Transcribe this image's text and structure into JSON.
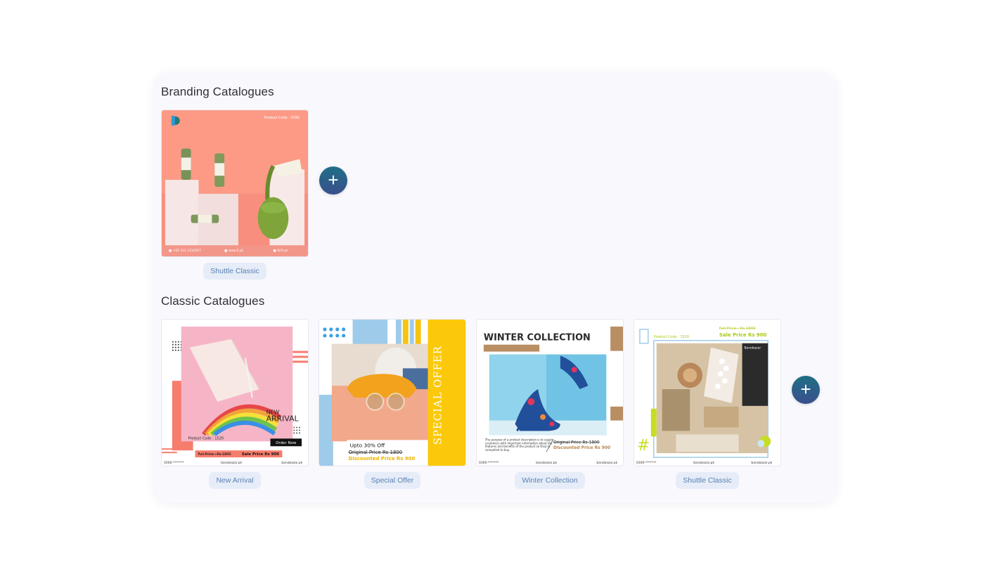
{
  "branding": {
    "title": "Branding Catalogues",
    "items": [
      {
        "label": "Shuttle Classic",
        "thumb": "drinks-product-post",
        "product_code": "Product Code : 0182"
      }
    ],
    "add_icon": "plus-icon"
  },
  "classic": {
    "title": "Classic Catalogues",
    "items": [
      {
        "label": "New Arrival",
        "thumb": "notebook-color-swatch-post",
        "headline_small": "NEW",
        "headline": "ARRIVAL",
        "product_code": "Product Code : 1520",
        "cta": "Order Now",
        "full_price": "Full Price : Rs 1800",
        "sale_price": "Sale Price  Rs 900",
        "footer": [
          "0300-*******",
          "banobazar.pk",
          "banobazar.pk"
        ]
      },
      {
        "label": "Special Offer",
        "thumb": "sunglasses-post",
        "side_text": "SPECIAL OFFER",
        "discount": "Upto 30% Off",
        "original_price": "Original Price  Rs 1800",
        "discounted_price": "Discounted Price  Rs 900"
      },
      {
        "label": "Winter Collection",
        "thumb": "high-heel-post",
        "headline": "WINTER COLLECTION",
        "original_price": "Original Price  Rs 1800",
        "discounted_price": "Discounted Price  Rs 900",
        "footer": [
          "0300-*******",
          "banobazar.pk",
          "banobazar.pk"
        ]
      },
      {
        "label": "Shuttle Classic",
        "thumb": "bath-kit-post",
        "full_price": "Full Price : Rs 1800",
        "sale_price": "Sale Price  Rs 900",
        "product_code": "Product Code : 1520",
        "brand": "Banobazar",
        "footer": [
          "0300-*******",
          "banobazar.pk",
          "banobazar.pk"
        ]
      }
    ],
    "add_icon": "plus-icon"
  },
  "colors": {
    "panel_bg": "#f9f9fd",
    "chip_bg": "#e6edf8",
    "chip_text": "#5a7fb2",
    "add_button_top": "#1f6f86",
    "add_button_bottom": "#3a4f8d"
  }
}
